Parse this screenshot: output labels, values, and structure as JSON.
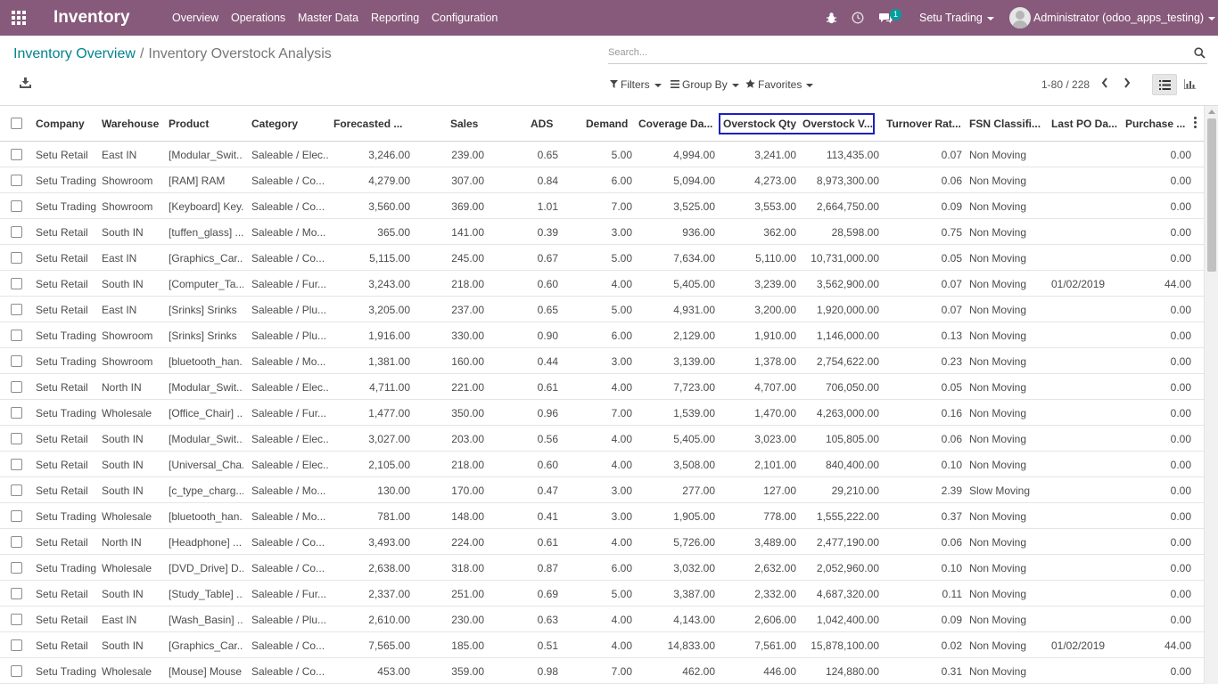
{
  "navbar": {
    "brand": "Inventory",
    "menus": [
      "Overview",
      "Operations",
      "Master Data",
      "Reporting",
      "Configuration"
    ],
    "messages_badge": "1",
    "company": "Setu Trading",
    "user": "Administrator (odoo_apps_testing)",
    "bg_color": "#875a7b"
  },
  "breadcrumb": {
    "parent": "Inventory Overview",
    "separator": "/",
    "current": "Inventory Overstock Analysis"
  },
  "search": {
    "placeholder": "Search..."
  },
  "filters": {
    "filters": "Filters",
    "group_by": "Group By",
    "favorites": "Favorites"
  },
  "pager": {
    "value": "1-80 / 228"
  },
  "icons": {
    "apps": "apps-grid-icon",
    "debug": "bug-icon",
    "activity": "clock-icon",
    "messages": "chat-icon",
    "download": "download-icon",
    "search": "magnifier-icon",
    "list_view": "list-icon",
    "graph_view": "bar-chart-icon"
  },
  "table": {
    "headers": [
      "Company",
      "Warehouse",
      "Product",
      "Category",
      "Forecasted ...",
      "Sales",
      "ADS",
      "Demand",
      "Coverage Da...",
      "Overstock Qty",
      "Overstock V...",
      "Turnover Rat...",
      "FSN Classifi...",
      "Last PO Da...",
      "Purchase ..."
    ],
    "rows": [
      [
        "Setu Retail",
        "East IN",
        "[Modular_Swit...",
        "Saleable / Elec...",
        "3,246.00",
        "239.00",
        "0.65",
        "5.00",
        "4,994.00",
        "3,241.00",
        "113,435.00",
        "0.07",
        "Non Moving",
        "",
        "0.00"
      ],
      [
        "Setu Trading",
        "Showroom",
        "[RAM] RAM",
        "Saleable / Co...",
        "4,279.00",
        "307.00",
        "0.84",
        "6.00",
        "5,094.00",
        "4,273.00",
        "8,973,300.00",
        "0.06",
        "Non Moving",
        "",
        "0.00"
      ],
      [
        "Setu Trading",
        "Showroom",
        "[Keyboard] Key...",
        "Saleable / Co...",
        "3,560.00",
        "369.00",
        "1.01",
        "7.00",
        "3,525.00",
        "3,553.00",
        "2,664,750.00",
        "0.09",
        "Non Moving",
        "",
        "0.00"
      ],
      [
        "Setu Retail",
        "South IN",
        "[tuffen_glass] ...",
        "Saleable / Mo...",
        "365.00",
        "141.00",
        "0.39",
        "3.00",
        "936.00",
        "362.00",
        "28,598.00",
        "0.75",
        "Non Moving",
        "",
        "0.00"
      ],
      [
        "Setu Retail",
        "East IN",
        "[Graphics_Car...",
        "Saleable / Co...",
        "5,115.00",
        "245.00",
        "0.67",
        "5.00",
        "7,634.00",
        "5,110.00",
        "10,731,000.00",
        "0.05",
        "Non Moving",
        "",
        "0.00"
      ],
      [
        "Setu Retail",
        "South IN",
        "[Computer_Ta...",
        "Saleable / Fur...",
        "3,243.00",
        "218.00",
        "0.60",
        "4.00",
        "5,405.00",
        "3,239.00",
        "3,562,900.00",
        "0.07",
        "Non Moving",
        "01/02/2019",
        "44.00"
      ],
      [
        "Setu Retail",
        "East IN",
        "[Srinks] Srinks",
        "Saleable / Plu...",
        "3,205.00",
        "237.00",
        "0.65",
        "5.00",
        "4,931.00",
        "3,200.00",
        "1,920,000.00",
        "0.07",
        "Non Moving",
        "",
        "0.00"
      ],
      [
        "Setu Trading",
        "Showroom",
        "[Srinks] Srinks",
        "Saleable / Plu...",
        "1,916.00",
        "330.00",
        "0.90",
        "6.00",
        "2,129.00",
        "1,910.00",
        "1,146,000.00",
        "0.13",
        "Non Moving",
        "",
        "0.00"
      ],
      [
        "Setu Trading",
        "Showroom",
        "[bluetooth_han...",
        "Saleable / Mo...",
        "1,381.00",
        "160.00",
        "0.44",
        "3.00",
        "3,139.00",
        "1,378.00",
        "2,754,622.00",
        "0.23",
        "Non Moving",
        "",
        "0.00"
      ],
      [
        "Setu Retail",
        "North IN",
        "[Modular_Swit...",
        "Saleable / Elec...",
        "4,711.00",
        "221.00",
        "0.61",
        "4.00",
        "7,723.00",
        "4,707.00",
        "706,050.00",
        "0.05",
        "Non Moving",
        "",
        "0.00"
      ],
      [
        "Setu Trading",
        "Wholesale",
        "[Office_Chair] ...",
        "Saleable / Fur...",
        "1,477.00",
        "350.00",
        "0.96",
        "7.00",
        "1,539.00",
        "1,470.00",
        "4,263,000.00",
        "0.16",
        "Non Moving",
        "",
        "0.00"
      ],
      [
        "Setu Retail",
        "South IN",
        "[Modular_Swit...",
        "Saleable / Elec...",
        "3,027.00",
        "203.00",
        "0.56",
        "4.00",
        "5,405.00",
        "3,023.00",
        "105,805.00",
        "0.06",
        "Non Moving",
        "",
        "0.00"
      ],
      [
        "Setu Retail",
        "South IN",
        "[Universal_Cha...",
        "Saleable / Elec...",
        "2,105.00",
        "218.00",
        "0.60",
        "4.00",
        "3,508.00",
        "2,101.00",
        "840,400.00",
        "0.10",
        "Non Moving",
        "",
        "0.00"
      ],
      [
        "Setu Retail",
        "South IN",
        "[c_type_charg...",
        "Saleable / Mo...",
        "130.00",
        "170.00",
        "0.47",
        "3.00",
        "277.00",
        "127.00",
        "29,210.00",
        "2.39",
        "Slow Moving",
        "",
        "0.00"
      ],
      [
        "Setu Trading",
        "Wholesale",
        "[bluetooth_han...",
        "Saleable / Mo...",
        "781.00",
        "148.00",
        "0.41",
        "3.00",
        "1,905.00",
        "778.00",
        "1,555,222.00",
        "0.37",
        "Non Moving",
        "",
        "0.00"
      ],
      [
        "Setu Retail",
        "North IN",
        "[Headphone] ...",
        "Saleable / Co...",
        "3,493.00",
        "224.00",
        "0.61",
        "4.00",
        "5,726.00",
        "3,489.00",
        "2,477,190.00",
        "0.06",
        "Non Moving",
        "",
        "0.00"
      ],
      [
        "Setu Trading",
        "Wholesale",
        "[DVD_Drive] D...",
        "Saleable / Co...",
        "2,638.00",
        "318.00",
        "0.87",
        "6.00",
        "3,032.00",
        "2,632.00",
        "2,052,960.00",
        "0.10",
        "Non Moving",
        "",
        "0.00"
      ],
      [
        "Setu Retail",
        "South IN",
        "[Study_Table] ...",
        "Saleable / Fur...",
        "2,337.00",
        "251.00",
        "0.69",
        "5.00",
        "3,387.00",
        "2,332.00",
        "4,687,320.00",
        "0.11",
        "Non Moving",
        "",
        "0.00"
      ],
      [
        "Setu Retail",
        "East IN",
        "[Wash_Basin] ...",
        "Saleable / Plu...",
        "2,610.00",
        "230.00",
        "0.63",
        "4.00",
        "4,143.00",
        "2,606.00",
        "1,042,400.00",
        "0.09",
        "Non Moving",
        "",
        "0.00"
      ],
      [
        "Setu Retail",
        "South IN",
        "[Graphics_Car...",
        "Saleable / Co...",
        "7,565.00",
        "185.00",
        "0.51",
        "4.00",
        "14,833.00",
        "7,561.00",
        "15,878,100.00",
        "0.02",
        "Non Moving",
        "01/02/2019",
        "44.00"
      ],
      [
        "Setu Trading",
        "Wholesale",
        "[Mouse] Mouse",
        "Saleable / Co...",
        "453.00",
        "359.00",
        "0.98",
        "7.00",
        "462.00",
        "446.00",
        "124,880.00",
        "0.31",
        "Non Moving",
        "",
        "0.00"
      ]
    ]
  }
}
